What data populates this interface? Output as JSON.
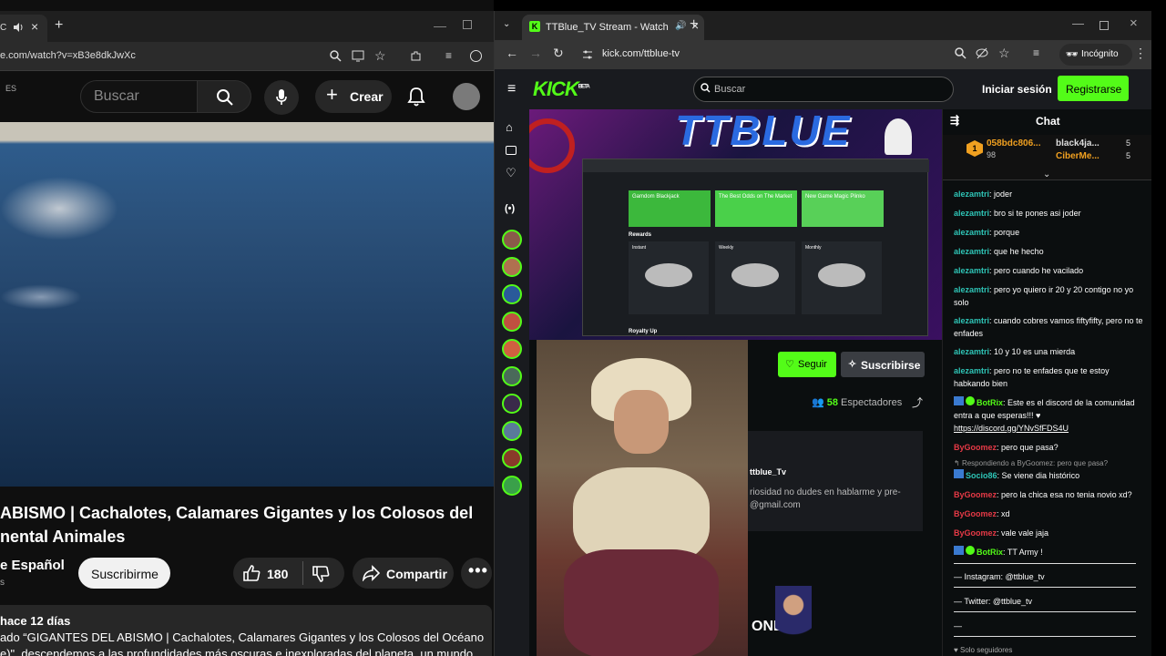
{
  "youtube": {
    "tab_close": "×",
    "tab_new": "+",
    "url": "e.com/watch?v=xB3e8dkJwXc",
    "country": "ES",
    "search_placeholder": "Buscar",
    "create_label": "Crear",
    "title_line1": "ABISMO | Cachalotes, Calamares Gigantes y los Colosos del",
    "title_line2": "nental Animales",
    "channel": "e Español",
    "channel_sub": "s",
    "subscribe_label": "Suscribirme",
    "likes": "180",
    "share_label": "Compartir",
    "desc_date": "hace 12 días",
    "desc_line1": "ado “GIGANTES DEL ABISMO | Cachalotes, Calamares Gigantes y los Colosos del Océano",
    "desc_line2": "e)\", descendemos a las profundidades más oscuras e inexploradas del planeta, un mundo"
  },
  "kick": {
    "tab_title": "TTBlue_TV Stream - Watch",
    "url": "kick.com/ttblue-tv",
    "incognito": "Incógnito",
    "logo": "KICK",
    "logo_badge": "BETA",
    "search_placeholder": "Buscar",
    "login": "Iniciar sesión",
    "register": "Registrarse",
    "stream_banner": "TTBLUE",
    "inner_rewards": "Rewards",
    "inner_royalty": "Royalty Up",
    "inner_promos": [
      "Gamdom Blackjack",
      "The Best Odds on The Market",
      "New Game Magic Plinko"
    ],
    "inner_cards": [
      "Instant",
      "Weekly",
      "Monthly"
    ],
    "follow": "Seguir",
    "subscribe": "Suscribirse",
    "viewers_count": "58",
    "viewers_label": "Espectadores",
    "about_name": "ttblue_Tv",
    "about_line1": "riosidad no dudes en hablarme y pre-",
    "about_line2": "@gmail.com",
    "bottom_text": "ONES",
    "chat_title": "Chat",
    "leaders": [
      {
        "name": "058bdc806...",
        "count": "98",
        "rank": "1"
      },
      {
        "name": "black4ja...",
        "count": "5"
      },
      {
        "name": "CiberMe...",
        "count": "5"
      }
    ],
    "messages": [
      {
        "user": "alezamtri",
        "text": "joder"
      },
      {
        "user": "alezamtri",
        "text": "bro si te pones asi joder"
      },
      {
        "user": "alezamtri",
        "text": "porque"
      },
      {
        "user": "alezamtri",
        "text": "que he hecho"
      },
      {
        "user": "alezamtri",
        "text": "pero cuando he vacilado"
      },
      {
        "user": "alezamtri",
        "text": "pero yo quiero ir 20 y 20 contigo no yo solo"
      },
      {
        "user": "alezamtri",
        "text": "cuando cobres vamos fiftyfifty, pero no te enfades"
      },
      {
        "user": "alezamtri",
        "text": "10 y 10 es una mierda"
      },
      {
        "user": "alezamtri",
        "text": "pero no te enfades que te estoy habkando bien"
      }
    ],
    "bot_msg1_user": "BotRix",
    "bot_msg1_text": "Este es el discord de la comunidad entra a que esperas!!! ♥",
    "bot_msg1_link": "https://discord.gg/YNvSfFDS4U",
    "m2_user": "ByGoomez",
    "m2_text": "pero que pasa?",
    "reply_to": "Respondiendo a ByGoomez: pero que pasa?",
    "m3_user": "Socio86",
    "m3_text": "Se viene dia histórico",
    "m4_user": "ByGoomez",
    "m4_text": "pero la chica esa no tenia novio xd?",
    "m5_user": "ByGoomez",
    "m5_text": "xd",
    "m6_user": "ByGoomez",
    "m6_text": "vale vale jaja",
    "m7_user": "BotRix",
    "m7_text": "TT Army !",
    "instagram": "— Instagram: @ttblue_tv",
    "twitter": "— Twitter: @ttblue_tv",
    "dash": "—",
    "followers_only": "Solo seguidores"
  },
  "colors": {
    "kick_green": "#53fc18",
    "chat_user": "#2ec4b6",
    "chat_red": "#e63946"
  }
}
